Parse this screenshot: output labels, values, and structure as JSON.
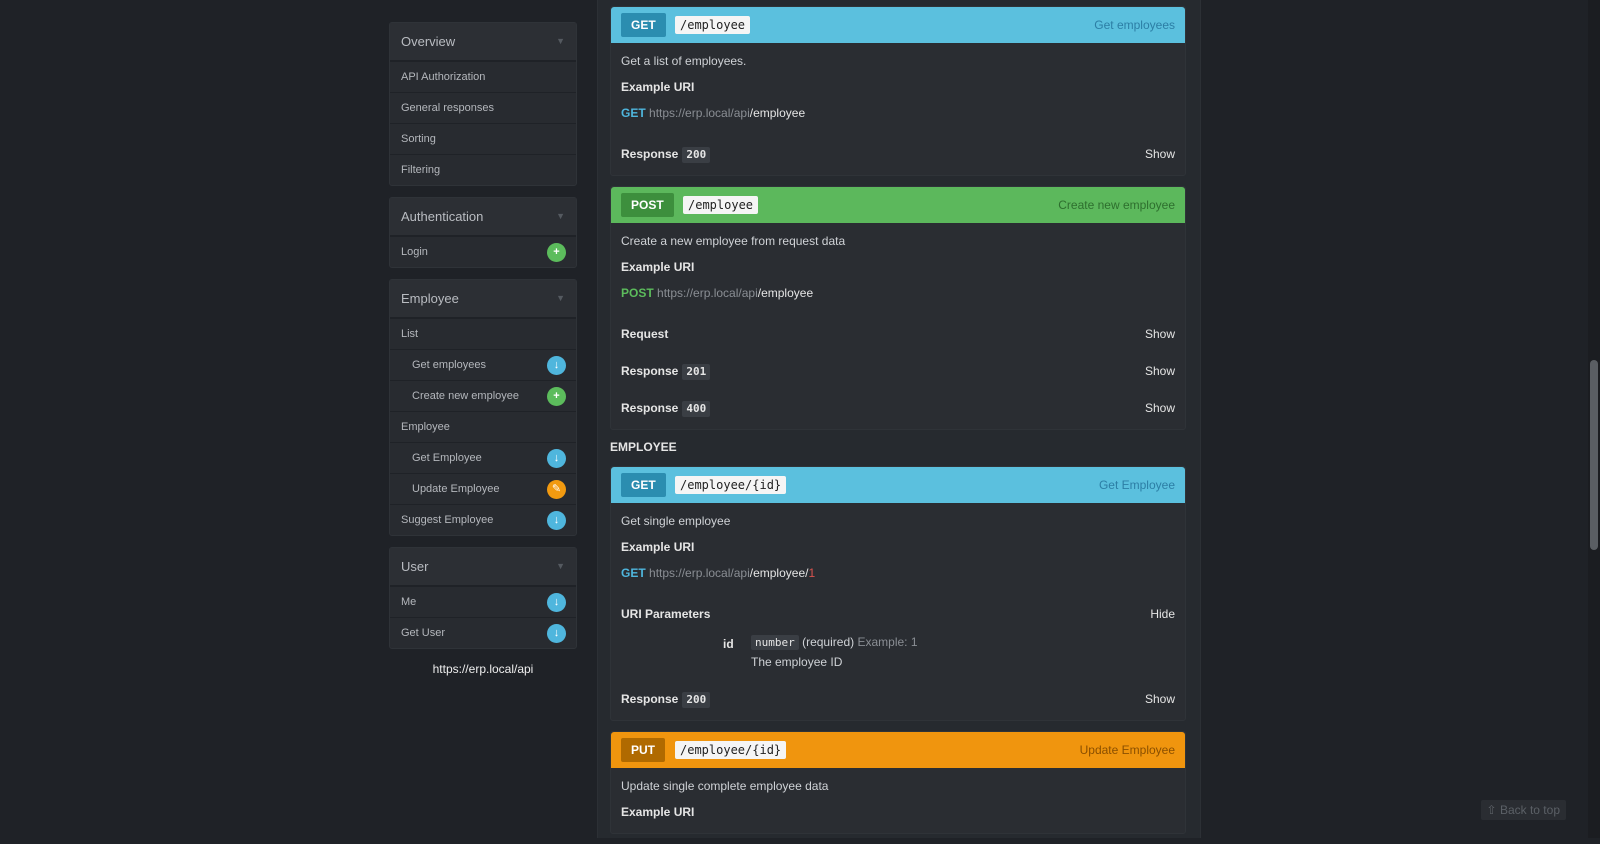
{
  "sidebar": {
    "sections": [
      {
        "title": "Overview",
        "items": [
          {
            "label": "API Authorization",
            "sub": false,
            "badge": null
          },
          {
            "label": "General responses",
            "sub": false,
            "badge": null
          },
          {
            "label": "Sorting",
            "sub": false,
            "badge": null
          },
          {
            "label": "Filtering",
            "sub": false,
            "badge": null
          }
        ]
      },
      {
        "title": "Authentication",
        "items": [
          {
            "label": "Login",
            "sub": false,
            "badge": "post"
          }
        ]
      },
      {
        "title": "Employee",
        "items": [
          {
            "label": "List",
            "sub": false,
            "badge": null
          },
          {
            "label": "Get employees",
            "sub": true,
            "badge": "get"
          },
          {
            "label": "Create new employee",
            "sub": true,
            "badge": "post"
          },
          {
            "label": "Employee",
            "sub": false,
            "badge": null
          },
          {
            "label": "Get Employee",
            "sub": true,
            "badge": "get"
          },
          {
            "label": "Update Employee",
            "sub": true,
            "badge": "put"
          },
          {
            "label": "Suggest Employee",
            "sub": false,
            "badge": "get"
          }
        ]
      },
      {
        "title": "User",
        "items": [
          {
            "label": "Me",
            "sub": false,
            "badge": "get"
          },
          {
            "label": "Get User",
            "sub": false,
            "badge": "get"
          }
        ]
      }
    ],
    "base_url": "https://erp.local/api"
  },
  "endpoints": {
    "get_employees": {
      "method": "GET",
      "path": "/employee",
      "title": "Get employees",
      "description": "Get a list of employees.",
      "example_label": "Example URI",
      "uri_method": "GET",
      "uri_host": "https://erp.local/api",
      "uri_resource": "/employee",
      "response_label": "Response",
      "response_code": "200",
      "toggle": "Show"
    },
    "create_employee": {
      "method": "POST",
      "path": "/employee",
      "title": "Create new employee",
      "description": "Create a new employee from request data",
      "example_label": "Example URI",
      "uri_method": "POST",
      "uri_host": "https://erp.local/api",
      "uri_resource": "/employee",
      "request_label": "Request",
      "request_toggle": "Show",
      "response_label": "Response",
      "response_code_1": "201",
      "response_code_2": "400",
      "toggle": "Show"
    },
    "group_title": "EMPLOYEE",
    "get_employee": {
      "method": "GET",
      "path": "/employee/{id}",
      "title": "Get Employee",
      "description": "Get single employee",
      "example_label": "Example URI",
      "uri_method": "GET",
      "uri_host": "https://erp.local/api",
      "uri_resource": "/employee/",
      "uri_param": "1",
      "params_label": "URI Parameters",
      "params_toggle": "Hide",
      "param_name": "id",
      "param_type": "number",
      "param_required": "(required)",
      "param_example": "Example: 1",
      "param_desc": "The employee ID",
      "response_label": "Response",
      "response_code": "200",
      "toggle": "Show"
    },
    "update_employee": {
      "method": "PUT",
      "path": "/employee/{id}",
      "title": "Update Employee",
      "description": "Update single complete employee data",
      "example_label": "Example URI"
    }
  },
  "back_to_top": "Back to top",
  "colors": {
    "get": "#5bc0de",
    "post": "#5cb85c",
    "put": "#f0950e",
    "background": "#1f2227"
  }
}
